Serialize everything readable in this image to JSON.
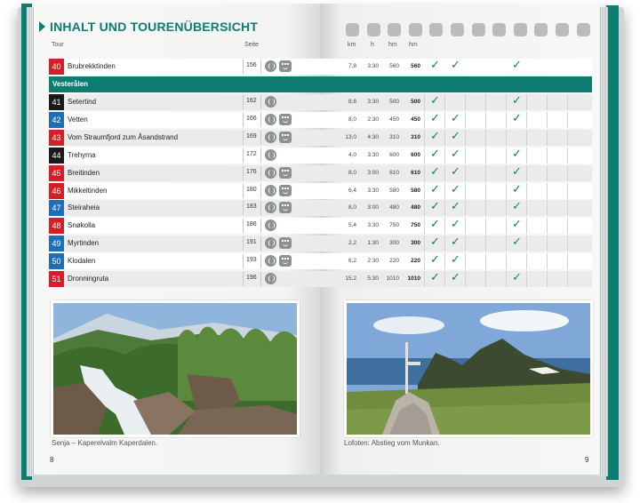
{
  "title": "INHALT UND TOURENÜBERSICHT",
  "headers": {
    "tour": "Tour",
    "seite": "Seite",
    "km": "km",
    "h": "h",
    "hm_up": "hm",
    "hm_down": "hm"
  },
  "header_icons": [
    "bus-icon",
    "hut-icon",
    "food-icon",
    "lake-icon",
    "bike-icon",
    "child-icon",
    "winter-icon",
    "exposed-icon",
    "summit-icon",
    "gps-icon",
    "boat-icon",
    "ski-icon"
  ],
  "top_row": {
    "num": "40",
    "name": "Brubrekktinden",
    "page": "156",
    "km": "7,8",
    "h": "3:30",
    "hm1": "560",
    "hm2": "560",
    "color": "#d41f26",
    "checks": [
      1,
      2,
      5
    ]
  },
  "region": "Vesterålen",
  "rows": [
    {
      "num": "41",
      "name": "Setertind",
      "page": "162",
      "km": "8,8",
      "h": "3:30",
      "hm1": "500",
      "hm2": "500",
      "color": "#1a1a1a",
      "face": false,
      "checks": [
        1,
        5
      ]
    },
    {
      "num": "42",
      "name": "Vetten",
      "page": "166",
      "km": "8,0",
      "h": "2:30",
      "hm1": "450",
      "hm2": "450",
      "color": "#1f6fb8",
      "face": true,
      "checks": [
        1,
        2,
        5
      ]
    },
    {
      "num": "43",
      "name": "Vom Straumfjord zum Åsandstrand",
      "page": "169",
      "km": "13,0",
      "h": "4:30",
      "hm1": "310",
      "hm2": "310",
      "color": "#d41f26",
      "face": true,
      "checks": [
        1,
        2
      ]
    },
    {
      "num": "44",
      "name": "Trehyrna",
      "page": "172",
      "km": "4,0",
      "h": "3:30",
      "hm1": "600",
      "hm2": "600",
      "color": "#1a1a1a",
      "face": false,
      "checks": [
        1,
        2,
        5
      ]
    },
    {
      "num": "45",
      "name": "Breitinden",
      "page": "176",
      "km": "8,0",
      "h": "3:00",
      "hm1": "610",
      "hm2": "610",
      "color": "#d41f26",
      "face": true,
      "checks": [
        1,
        2,
        5
      ]
    },
    {
      "num": "46",
      "name": "Mikkeltinden",
      "page": "180",
      "km": "6,4",
      "h": "3:30",
      "hm1": "580",
      "hm2": "580",
      "color": "#d41f26",
      "face": true,
      "checks": [
        1,
        2,
        5
      ]
    },
    {
      "num": "47",
      "name": "Steiraheia",
      "page": "183",
      "km": "8,0",
      "h": "3:00",
      "hm1": "480",
      "hm2": "480",
      "color": "#1f6fb8",
      "face": true,
      "checks": [
        1,
        2,
        5
      ]
    },
    {
      "num": "48",
      "name": "Snøkolla",
      "page": "186",
      "km": "5,4",
      "h": "3:30",
      "hm1": "750",
      "hm2": "750",
      "color": "#d41f26",
      "face": false,
      "checks": [
        1,
        2,
        5
      ]
    },
    {
      "num": "49",
      "name": "Myrtinden",
      "page": "191",
      "km": "2,2",
      "h": "1:30",
      "hm1": "300",
      "hm2": "300",
      "color": "#1f6fb8",
      "face": true,
      "checks": [
        1,
        2,
        5
      ]
    },
    {
      "num": "50",
      "name": "Klodalen",
      "page": "193",
      "km": "6,2",
      "h": "2:30",
      "hm1": "220",
      "hm2": "220",
      "color": "#1f6fb8",
      "face": true,
      "checks": [
        1,
        2
      ]
    },
    {
      "num": "51",
      "name": "Dronningruta",
      "page": "196",
      "km": "15,2",
      "h": "5:30",
      "hm1": "1010",
      "hm2": "1010",
      "color": "#d41f26",
      "face": false,
      "checks": [
        1,
        2,
        5
      ]
    }
  ],
  "captions": {
    "left": "Senja – Kaperelvalm Kaperdalen.",
    "right": "Lofoten: Abstieg vom Munkan."
  },
  "page_numbers": {
    "left": "8",
    "right": "9"
  },
  "check_symbol": "✓",
  "accent": "#0d7d72"
}
